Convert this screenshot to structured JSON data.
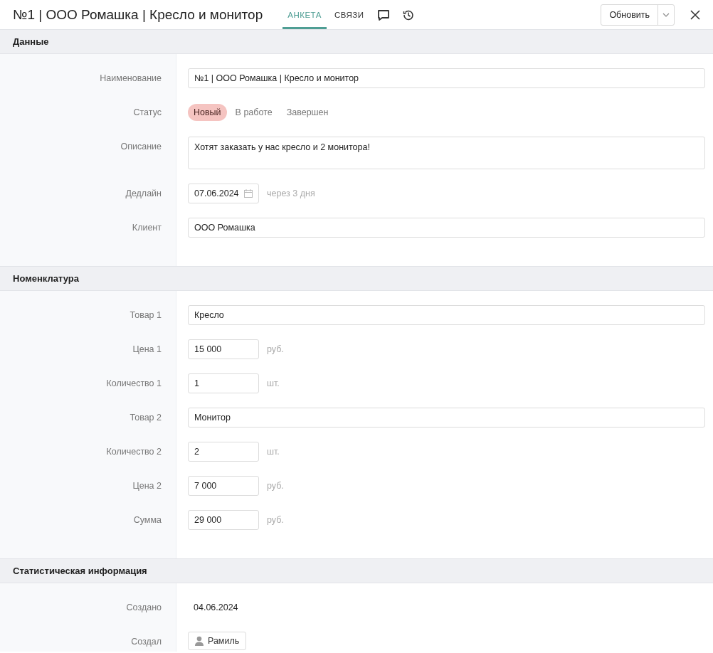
{
  "header": {
    "title": "№1 | ООО Ромашка | Кресло и монитор",
    "tabs": [
      {
        "kind": "text",
        "label": "АНКЕТА",
        "selected": true
      },
      {
        "kind": "text",
        "label": "СВЯЗИ",
        "selected": false
      },
      {
        "kind": "comments",
        "selected": false
      },
      {
        "kind": "history",
        "selected": false
      }
    ],
    "refresh_button": "Обновить"
  },
  "sections": [
    {
      "title": "Данные",
      "rows": [
        {
          "label": "Наименование",
          "kind": "text",
          "value": "№1 | ООО Ромашка | Кресло и монитор"
        },
        {
          "label": "Статус",
          "kind": "status",
          "options": [
            {
              "label": "Новый",
              "selected": true
            },
            {
              "label": "В работе",
              "selected": false
            },
            {
              "label": "Завершен",
              "selected": false
            }
          ]
        },
        {
          "label": "Описание",
          "kind": "textarea",
          "value": "Хотят заказать у нас кресло и 2 монитора!"
        },
        {
          "label": "Дедлайн",
          "kind": "date",
          "value": "07.06.2024",
          "note": "через 3 дня"
        },
        {
          "label": "Клиент",
          "kind": "text",
          "value": "ООО Ромашка"
        }
      ]
    },
    {
      "title": "Номенклатура",
      "rows": [
        {
          "label": "Товар 1",
          "kind": "text",
          "value": "Кресло"
        },
        {
          "label": "Цена 1",
          "kind": "short",
          "value": "15 000",
          "note": "руб."
        },
        {
          "label": "Количество 1",
          "kind": "short",
          "value": "1",
          "note": "шт."
        },
        {
          "label": "Товар 2",
          "kind": "text",
          "value": "Монитор"
        },
        {
          "label": "Количество 2",
          "kind": "short",
          "value": "2",
          "note": "шт."
        },
        {
          "label": "Цена 2",
          "kind": "short",
          "value": "7 000",
          "note": "руб."
        },
        {
          "label": "Сумма",
          "kind": "short",
          "value": "29 000",
          "note": "руб."
        }
      ]
    },
    {
      "title": "Статистическая информация",
      "rows": [
        {
          "label": "Создано",
          "kind": "plain",
          "value": "04.06.2024"
        },
        {
          "label": "Создал",
          "kind": "user",
          "value": "Рамиль"
        }
      ]
    }
  ]
}
